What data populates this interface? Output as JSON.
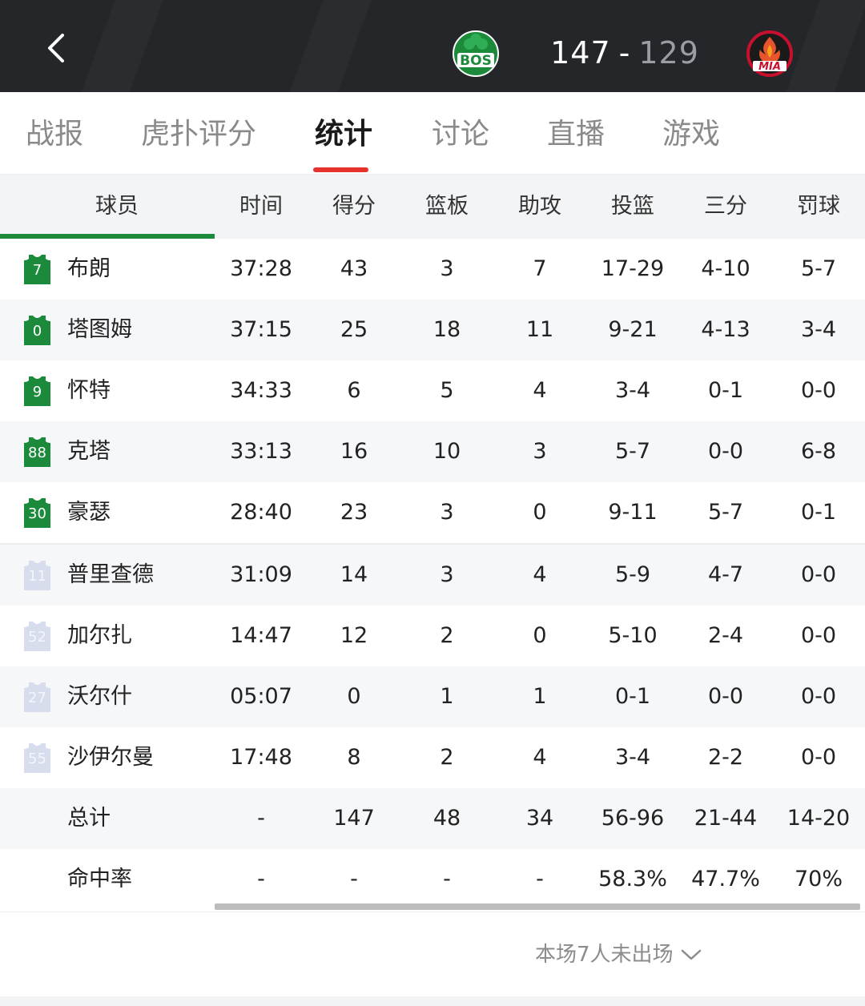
{
  "header": {
    "home_team": "BOS",
    "away_team": "MIA",
    "home_score": "147",
    "away_score": "129",
    "score_separator": "-",
    "colors": {
      "bar": "#24262a",
      "home": "#1b8a3a",
      "away": "#c8102e"
    },
    "icons": {
      "back": "chevron-left-icon",
      "home_logo": "celtics-logo-icon",
      "away_logo": "heat-logo-icon"
    }
  },
  "tabs": [
    {
      "label": "战报"
    },
    {
      "label": "虎扑评分"
    },
    {
      "label": "统计",
      "active": true
    },
    {
      "label": "讨论"
    },
    {
      "label": "直播"
    },
    {
      "label": "游戏"
    }
  ],
  "table": {
    "columns": [
      "球员",
      "时间",
      "得分",
      "篮板",
      "助攻",
      "投篮",
      "三分",
      "罚球"
    ],
    "starters": [
      {
        "number": "7",
        "name": "布朗",
        "min": "37:28",
        "pts": "43",
        "reb": "3",
        "ast": "7",
        "fg": "17-29",
        "tp": "4-10",
        "ft": "5-7"
      },
      {
        "number": "0",
        "name": "塔图姆",
        "min": "37:15",
        "pts": "25",
        "reb": "18",
        "ast": "11",
        "fg": "9-21",
        "tp": "4-13",
        "ft": "3-4"
      },
      {
        "number": "9",
        "name": "怀特",
        "min": "34:33",
        "pts": "6",
        "reb": "5",
        "ast": "4",
        "fg": "3-4",
        "tp": "0-1",
        "ft": "0-0"
      },
      {
        "number": "88",
        "name": "克塔",
        "min": "33:13",
        "pts": "16",
        "reb": "10",
        "ast": "3",
        "fg": "5-7",
        "tp": "0-0",
        "ft": "6-8"
      },
      {
        "number": "30",
        "name": "豪瑟",
        "min": "28:40",
        "pts": "23",
        "reb": "3",
        "ast": "0",
        "fg": "9-11",
        "tp": "5-7",
        "ft": "0-1"
      }
    ],
    "bench": [
      {
        "number": "11",
        "name": "普里查德",
        "min": "31:09",
        "pts": "14",
        "reb": "3",
        "ast": "4",
        "fg": "5-9",
        "tp": "4-7",
        "ft": "0-0"
      },
      {
        "number": "52",
        "name": "加尔扎",
        "min": "14:47",
        "pts": "12",
        "reb": "2",
        "ast": "0",
        "fg": "5-10",
        "tp": "2-4",
        "ft": "0-0"
      },
      {
        "number": "27",
        "name": "沃尔什",
        "min": "05:07",
        "pts": "0",
        "reb": "1",
        "ast": "1",
        "fg": "0-1",
        "tp": "0-0",
        "ft": "0-0"
      },
      {
        "number": "55",
        "name": "沙伊尔曼",
        "min": "17:48",
        "pts": "8",
        "reb": "2",
        "ast": "4",
        "fg": "3-4",
        "tp": "2-2",
        "ft": "0-0"
      }
    ],
    "totals": {
      "label": "总计",
      "min": "-",
      "pts": "147",
      "reb": "48",
      "ast": "34",
      "fg": "56-96",
      "tp": "21-44",
      "ft": "14-20"
    },
    "pct": {
      "label": "命中率",
      "min": "-",
      "pts": "-",
      "reb": "-",
      "ast": "-",
      "fg": "58.3%",
      "tp": "47.7%",
      "ft": "70%"
    }
  },
  "footer": {
    "dnp_label": "本场7人未出场",
    "dnp_icon": "chevron-down-icon"
  }
}
